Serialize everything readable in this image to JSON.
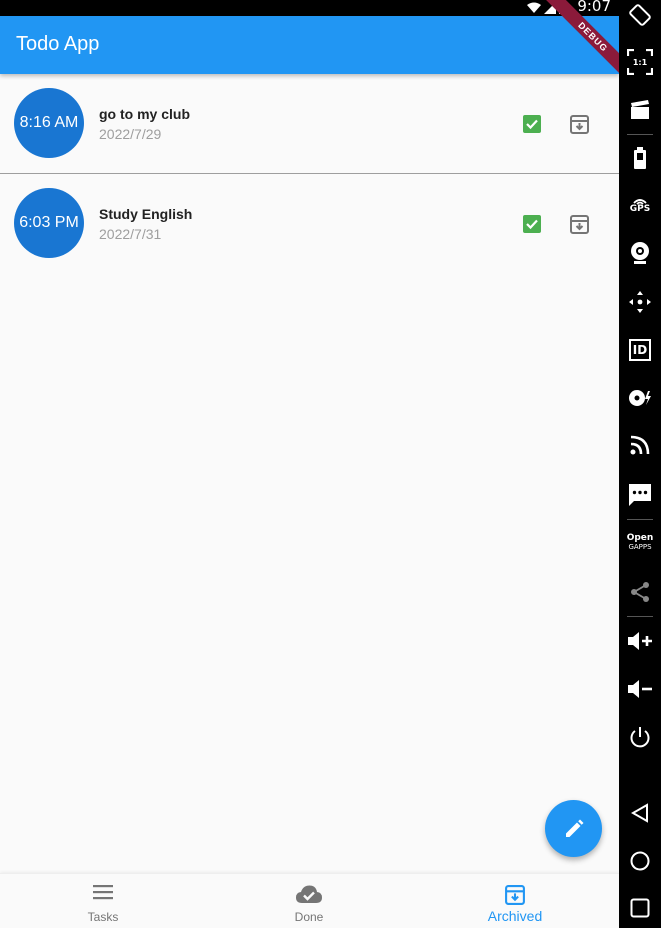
{
  "status_bar": {
    "time": "9:07"
  },
  "app_bar": {
    "title": "Todo App",
    "debug_banner": "DEBUG"
  },
  "tasks": [
    {
      "time": "8:16 AM",
      "title": "go to my club",
      "date": "2022/7/29"
    },
    {
      "time": "6:03 PM",
      "title": "Study English",
      "date": "2022/7/31"
    }
  ],
  "bottom_nav": {
    "items": [
      {
        "label": "Tasks",
        "icon": "menu-icon"
      },
      {
        "label": "Done",
        "icon": "cloud-done-icon"
      },
      {
        "label": "Archived",
        "icon": "archive-icon",
        "active": true
      }
    ]
  },
  "emulator_toolbar": {
    "ratio_label": "1:1",
    "gps_label": "GPS",
    "id_label": "ID",
    "opengapps_label_1": "Open",
    "opengapps_label_2": "GAPPS"
  },
  "colors": {
    "primary": "#2196f3",
    "avatar": "#1976d2",
    "check": "#4caf50"
  }
}
